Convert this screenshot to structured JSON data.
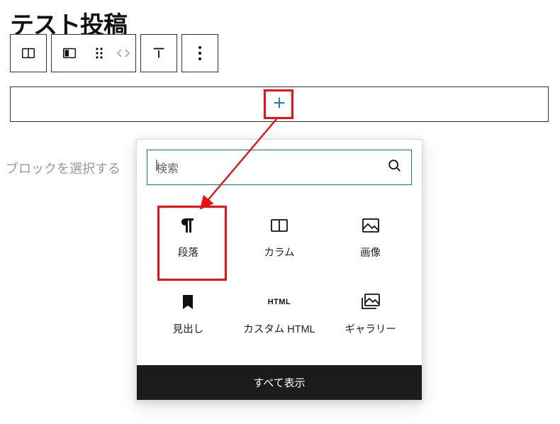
{
  "title": "テスト投稿",
  "toolbar": {
    "parent_icon": "columns-icon",
    "block_icon": "column-icon",
    "move_icon": "drag-handle-icon",
    "updown_icon": "up-down-icon",
    "align_icon": "align-top-icon",
    "more_icon": "more-icon"
  },
  "inserter": {
    "add_icon": "plus-icon",
    "select_block_text": "ブロックを選択する",
    "search_placeholder": "検索",
    "search_icon": "search-icon",
    "blocks": [
      {
        "key": "paragraph",
        "label": "段落",
        "icon": "paragraph-icon"
      },
      {
        "key": "columns",
        "label": "カラム",
        "icon": "columns-icon"
      },
      {
        "key": "image",
        "label": "画像",
        "icon": "image-icon"
      },
      {
        "key": "heading",
        "label": "見出し",
        "icon": "bookmark-icon"
      },
      {
        "key": "custom-html",
        "label": "カスタム HTML",
        "icon": "html-icon",
        "icon_text": "HTML"
      },
      {
        "key": "gallery",
        "label": "ギャラリー",
        "icon": "gallery-icon"
      }
    ],
    "show_all_label": "すべて表示"
  },
  "annotation": {
    "accent": "#ee1111"
  }
}
